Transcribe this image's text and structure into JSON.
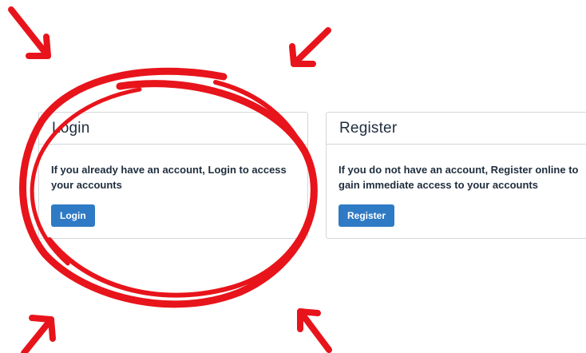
{
  "login_card": {
    "title": "Login",
    "description": "If you already have an account, Login to access your accounts",
    "button_label": "Login"
  },
  "register_card": {
    "title": "Register",
    "description": "If you do not have an account, Register online to gain immediate access to your accounts",
    "button_label": "Register"
  },
  "colors": {
    "button": "#2f7ac4",
    "annotation": "#e8141b",
    "border": "#d3d6da"
  },
  "annotations": {
    "highlight": "red-hand-drawn-circle",
    "arrows": [
      "arrow-icon",
      "arrow-icon",
      "arrow-icon",
      "arrow-icon"
    ]
  }
}
